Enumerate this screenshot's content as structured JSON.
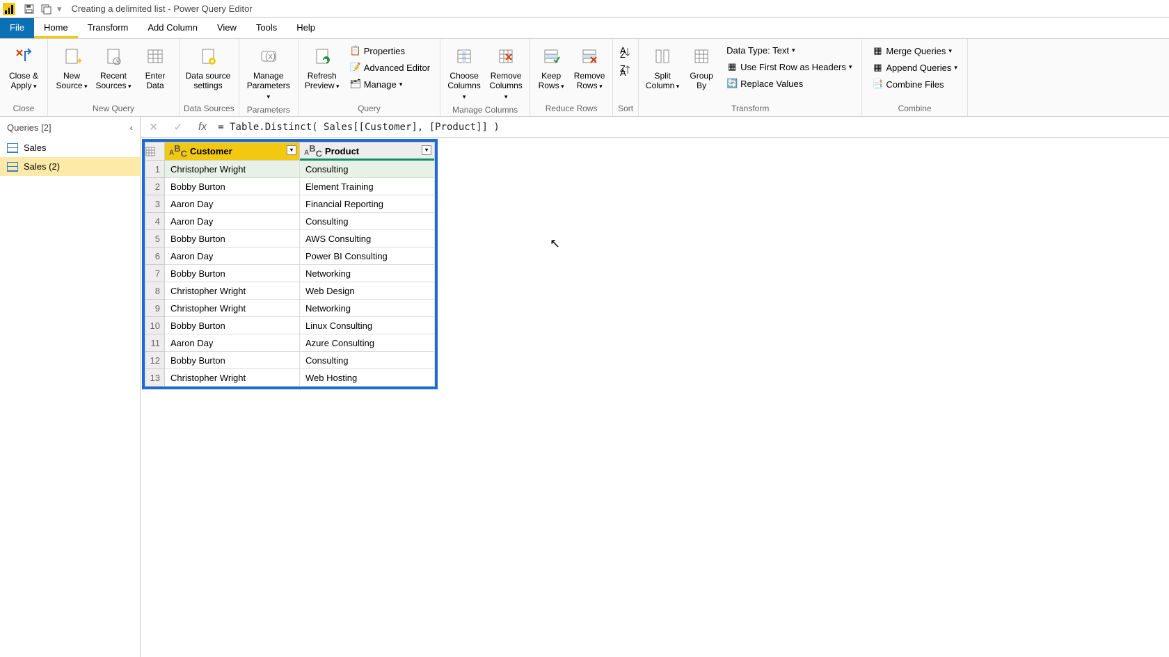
{
  "title": "Creating a delimited list - Power Query Editor",
  "tabs": {
    "file": "File",
    "home": "Home",
    "transform": "Transform",
    "addcol": "Add Column",
    "view": "View",
    "tools": "Tools",
    "help": "Help"
  },
  "ribbon": {
    "close_apply": "Close & Apply",
    "close_group": "Close",
    "new_source": "New Source",
    "recent_sources": "Recent Sources",
    "enter_data": "Enter Data",
    "new_query_group": "New Query",
    "data_source_settings": "Data source settings",
    "data_sources_group": "Data Sources",
    "manage_parameters": "Manage Parameters",
    "parameters_group": "Parameters",
    "refresh_preview": "Refresh Preview",
    "properties": "Properties",
    "adv_editor": "Advanced Editor",
    "manage": "Manage",
    "query_group": "Query",
    "choose_cols": "Choose Columns",
    "remove_cols": "Remove Columns",
    "manage_cols_group": "Manage Columns",
    "keep_rows": "Keep Rows",
    "remove_rows": "Remove Rows",
    "reduce_rows_group": "Reduce Rows",
    "sort_group": "Sort",
    "split_col": "Split Column",
    "group_by": "Group By",
    "data_type": "Data Type: Text",
    "first_row": "Use First Row as Headers",
    "replace_vals": "Replace Values",
    "transform_group": "Transform",
    "merge_q": "Merge Queries",
    "append_q": "Append Queries",
    "combine_files": "Combine Files",
    "combine_group": "Combine"
  },
  "queries_header": "Queries [2]",
  "queries": [
    "Sales",
    "Sales (2)"
  ],
  "formula": "= Table.Distinct( Sales[[Customer], [Product]] )",
  "columns": {
    "customer": "Customer",
    "product": "Product"
  },
  "rows": [
    {
      "n": "1",
      "customer": "Christopher Wright",
      "product": "Consulting"
    },
    {
      "n": "2",
      "customer": "Bobby Burton",
      "product": "Element Training"
    },
    {
      "n": "3",
      "customer": "Aaron Day",
      "product": "Financial Reporting"
    },
    {
      "n": "4",
      "customer": "Aaron Day",
      "product": "Consulting"
    },
    {
      "n": "5",
      "customer": "Bobby Burton",
      "product": "AWS Consulting"
    },
    {
      "n": "6",
      "customer": "Aaron Day",
      "product": "Power BI Consulting"
    },
    {
      "n": "7",
      "customer": "Bobby Burton",
      "product": "Networking"
    },
    {
      "n": "8",
      "customer": "Christopher Wright",
      "product": "Web Design"
    },
    {
      "n": "9",
      "customer": "Christopher Wright",
      "product": "Networking"
    },
    {
      "n": "10",
      "customer": "Bobby Burton",
      "product": "Linux Consulting"
    },
    {
      "n": "11",
      "customer": "Aaron Day",
      "product": "Azure Consulting"
    },
    {
      "n": "12",
      "customer": "Bobby Burton",
      "product": "Consulting"
    },
    {
      "n": "13",
      "customer": "Christopher Wright",
      "product": "Web Hosting"
    }
  ]
}
